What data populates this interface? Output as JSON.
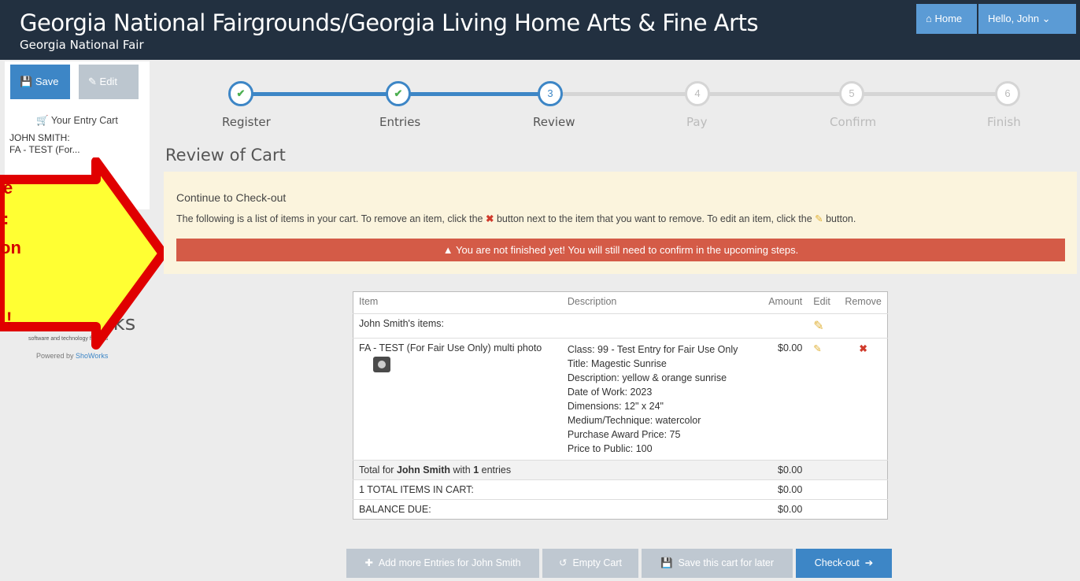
{
  "header": {
    "title": "Georgia National Fairgrounds/Georgia Living Home Arts & Fine Arts",
    "subtitle": "Georgia National Fair",
    "home_label": "Home",
    "user_label": "Hello, John"
  },
  "sidebar": {
    "save_label": "Save",
    "edit_label": "Edit",
    "cart_label": "Your Entry Cart",
    "name": "JOHN SMITH:",
    "item": "FA - TEST (For..."
  },
  "logo": {
    "word": "ShoWorks",
    "tagline": "software and technology for fairs",
    "powered_prefix": "Powered by ",
    "powered_link": "ShoWorks"
  },
  "annotation": {
    "line1": "e",
    "line2": ":",
    "line3": "on",
    "line4": "!"
  },
  "steps": [
    {
      "num": "✔",
      "label": "Register",
      "state": "done"
    },
    {
      "num": "✔",
      "label": "Entries",
      "state": "done"
    },
    {
      "num": "3",
      "label": "Review",
      "state": "active"
    },
    {
      "num": "4",
      "label": "Pay",
      "state": "pending"
    },
    {
      "num": "5",
      "label": "Confirm",
      "state": "pending"
    },
    {
      "num": "6",
      "label": "Finish",
      "state": "pending"
    }
  ],
  "review_title": "Review of Cart",
  "panel": {
    "heading": "Continue to Check-out",
    "text_before": "The following is a list of items in your cart. To remove an item, click the",
    "text_middle": "button next to the item that you want to remove. To edit an item, click the",
    "text_after": "button.",
    "alert": "You are not finished yet! You will still need to confirm in the upcoming steps."
  },
  "table": {
    "headers": {
      "item": "Item",
      "description": "Description",
      "amount": "Amount",
      "edit": "Edit",
      "remove": "Remove"
    },
    "group_label": "John Smith's items:",
    "entry": {
      "item": "FA - TEST (For Fair Use Only) multi photo",
      "description": [
        "Class: 99 - Test Entry for Fair Use Only",
        "Title: Magestic Sunrise",
        "Description: yellow & orange sunrise",
        "Date of Work: 2023",
        "Dimensions: 12\" x 24\"",
        "Medium/Technique: watercolor",
        "Purchase Award Price: 75",
        "Price to Public: 100"
      ],
      "amount": "$0.00"
    },
    "total_prefix": "Total for ",
    "total_name": "John Smith",
    "total_with": " with ",
    "total_count": "1",
    "total_suffix": " entries",
    "total_amount": "$0.00",
    "items_in_cart": "1 TOTAL ITEMS IN CART:",
    "items_amount": "$0.00",
    "balance_label": "BALANCE DUE:",
    "balance_amount": "$0.00"
  },
  "actions": {
    "add_more": "Add more Entries for John Smith",
    "empty": "Empty Cart",
    "save_later": "Save this cart for later",
    "checkout": "Check-out"
  }
}
